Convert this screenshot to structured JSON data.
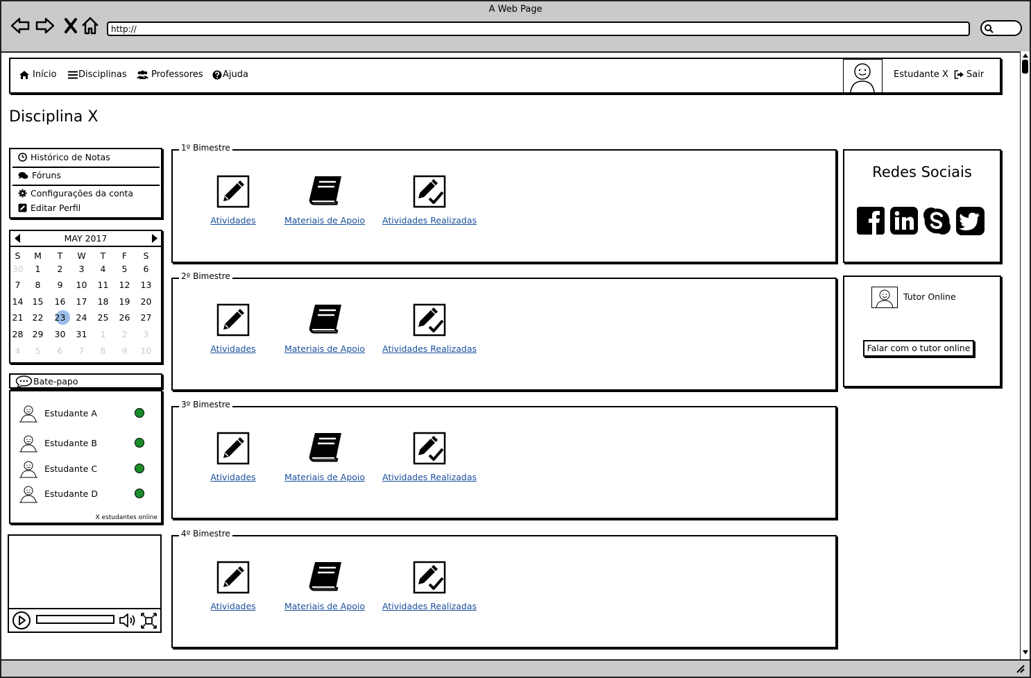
{
  "browser": {
    "window_title": "A Web Page",
    "url": "http://"
  },
  "nav": {
    "items": [
      {
        "label": "Início",
        "icon": "home-icon"
      },
      {
        "label": "Disciplinas",
        "icon": "list-icon"
      },
      {
        "label": "Professores",
        "icon": "users-icon"
      },
      {
        "label": "Ajuda",
        "icon": "help-icon"
      }
    ],
    "user_name": "Estudante X",
    "logout_label": "Sair"
  },
  "page": {
    "title": "Disciplina X"
  },
  "left_menu": {
    "items": [
      {
        "label": "Histórico de Notas",
        "icon": "clock-icon"
      },
      {
        "label": "Fóruns",
        "icon": "comments-icon"
      },
      {
        "label": "Configurações da conta",
        "icon": "gear-icon"
      },
      {
        "label": "Editar Perfil",
        "icon": "edit-icon"
      }
    ]
  },
  "calendar": {
    "month_label": "MAY 2017",
    "weekdays": [
      "S",
      "M",
      "T",
      "W",
      "T",
      "F",
      "S"
    ],
    "weeks": [
      [
        "30",
        "1",
        "2",
        "3",
        "4",
        "5",
        "6"
      ],
      [
        "7",
        "8",
        "9",
        "10",
        "11",
        "12",
        "13"
      ],
      [
        "14",
        "15",
        "16",
        "17",
        "18",
        "19",
        "20"
      ],
      [
        "21",
        "22",
        "23",
        "24",
        "25",
        "26",
        "27"
      ],
      [
        "28",
        "29",
        "30",
        "31",
        "1",
        "2",
        "3"
      ],
      [
        "4",
        "5",
        "6",
        "7",
        "8",
        "9",
        "10"
      ]
    ],
    "selected_day": "23"
  },
  "chat": {
    "title": "Bate-papo",
    "students": [
      {
        "name": "Estudante A",
        "status": "online"
      },
      {
        "name": "Estudante B",
        "status": "online"
      },
      {
        "name": "Estudante C",
        "status": "online"
      },
      {
        "name": "Estudante D",
        "status": "online"
      }
    ],
    "online_count": "X estudantes online",
    "status_color": "#1a8c2a"
  },
  "bimestres": [
    {
      "title": "1º Bimestre",
      "links": [
        "Atividades",
        "Materiais de Apoio",
        "Atividades Realizadas"
      ]
    },
    {
      "title": "2º Bimestre",
      "links": [
        "Atividades",
        "Materiais de Apoio",
        "Atividades Realizadas"
      ]
    },
    {
      "title": "3º Bimestre",
      "links": [
        "Atividades",
        "Materiais de Apoio",
        "Atividades Realizadas"
      ]
    },
    {
      "title": "4º Bimestre",
      "links": [
        "Atividades",
        "Materiais de Apoio",
        "Atividades Realizadas"
      ]
    }
  ],
  "social": {
    "title": "Redes Sociais",
    "networks": [
      "facebook-icon",
      "linkedin-icon",
      "skype-icon",
      "twitter-icon"
    ]
  },
  "tutor": {
    "label": "Tutor Online",
    "button_label": "Falar com o tutor online"
  },
  "colors": {
    "link": "#1a4f9c",
    "selected_day": "#9cbee8",
    "chrome": "#cacaca"
  }
}
